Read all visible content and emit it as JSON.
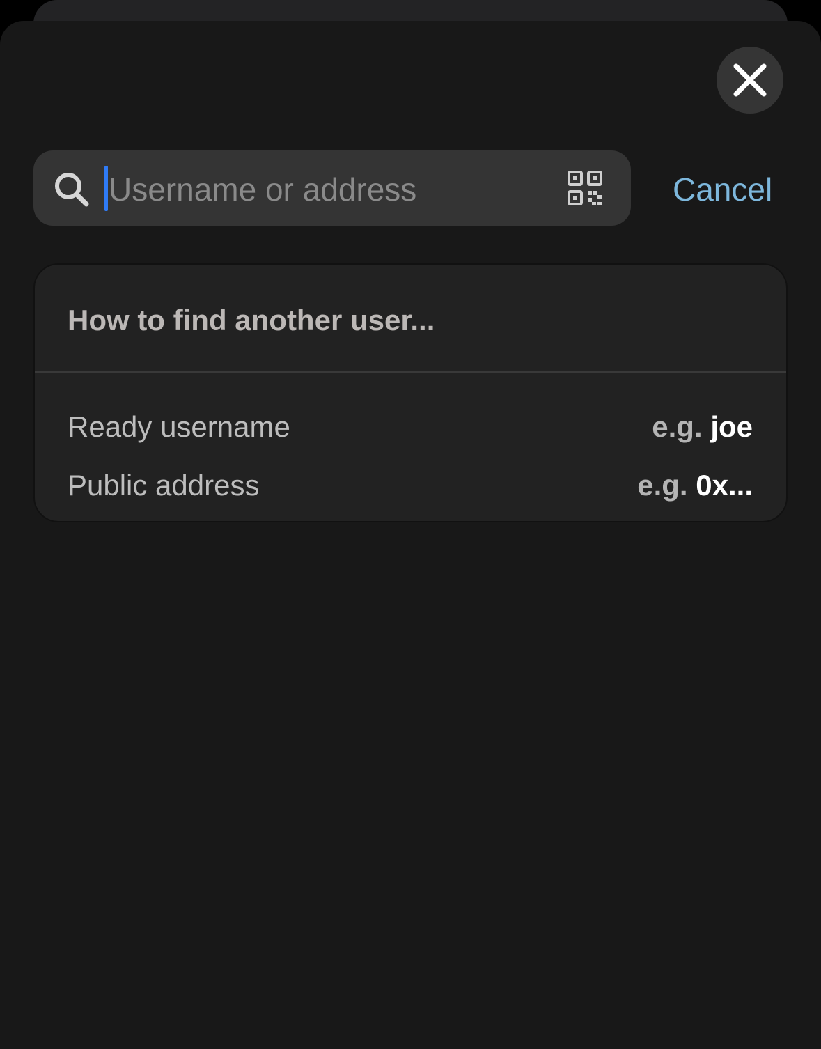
{
  "search": {
    "placeholder": "Username or address",
    "value": "",
    "cancel_label": "Cancel"
  },
  "help": {
    "title": "How to find another user...",
    "rows": [
      {
        "label": "Ready username",
        "prefix": "e.g.",
        "example": "joe"
      },
      {
        "label": "Public address",
        "prefix": "e.g.",
        "example": "0x..."
      }
    ]
  },
  "icons": {
    "close": "close-icon",
    "search": "search-icon",
    "qr": "qr-code-icon"
  },
  "colors": {
    "background": "#181818",
    "accent": "#7db7dc",
    "caret": "#2f7bf6",
    "card": "#222222"
  }
}
